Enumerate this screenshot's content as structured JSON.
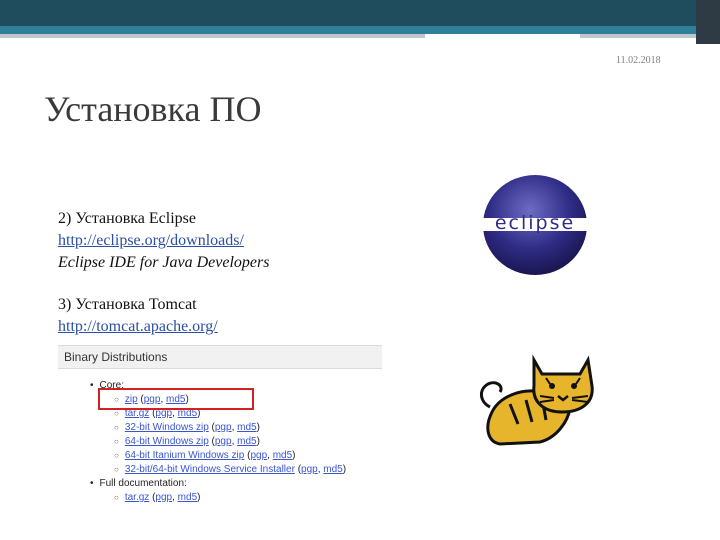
{
  "header": {
    "date": "11.02.2018"
  },
  "title": "Установка ПО",
  "section_eclipse": {
    "heading": "2) Установка Eclipse",
    "link": "http://eclipse.org/downloads/",
    "subtitle": "Eclipse IDE for Java Developers",
    "logo_text": "eclipse"
  },
  "section_tomcat": {
    "heading": "3) Установка Tomcat",
    "link": "http://tomcat.apache.org/"
  },
  "binary": {
    "title": "Binary Distributions",
    "core_label": "Core:",
    "core_items": [
      {
        "name": "zip",
        "pgp": "pgp",
        "md5": "md5"
      },
      {
        "name": "tar.gz",
        "pgp": "pgp",
        "md5": "md5"
      },
      {
        "name": "32-bit Windows zip",
        "pgp": "pgp",
        "md5": "md5"
      },
      {
        "name": "64-bit Windows zip",
        "pgp": "pgp",
        "md5": "md5"
      },
      {
        "name": "64-bit Itanium Windows zip",
        "pgp": "pgp",
        "md5": "md5"
      },
      {
        "name": "32-bit/64-bit Windows Service Installer",
        "pgp": "pgp",
        "md5": "md5"
      }
    ],
    "full_doc_label": "Full documentation:",
    "doc_items": [
      {
        "name": "tar.gz",
        "pgp": "pgp",
        "md5": "md5"
      }
    ]
  },
  "colors": {
    "header_dark": "#1f4d5e",
    "header_teal": "#2f7f98",
    "link_blue": "#2a4ea6",
    "highlight_red": "#d42020"
  }
}
